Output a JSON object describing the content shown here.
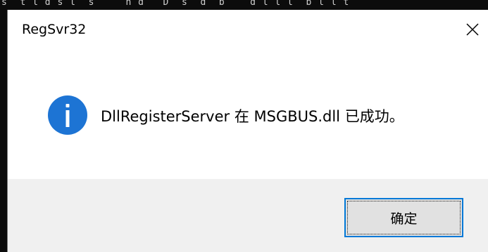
{
  "console": {
    "text": "s  t l d s l  s     n d   D  s  d  b    d l l l  b l l t"
  },
  "dialog": {
    "title": "RegSvr32",
    "message": "DllRegisterServer 在 MSGBUS.dll 已成功。",
    "ok_label": "确定",
    "icon": "info-icon"
  },
  "colors": {
    "icon_blue": "#1d74d4",
    "button_border": "#0078d7",
    "footer_bg": "#f0f0f0"
  }
}
